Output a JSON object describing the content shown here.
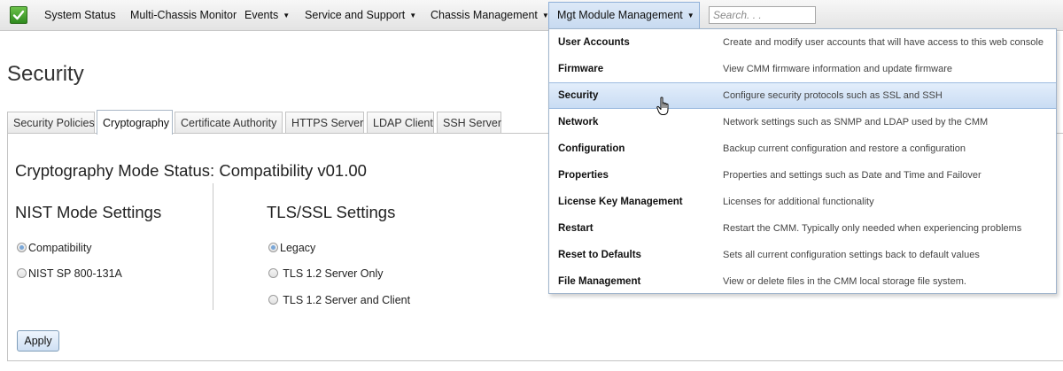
{
  "topnav": {
    "items": [
      {
        "label": "System Status",
        "caret": false
      },
      {
        "label": "Multi-Chassis Monitor",
        "caret": false
      },
      {
        "label": "Events",
        "caret": true
      },
      {
        "label": "Service and Support",
        "caret": true
      },
      {
        "label": "Chassis Management",
        "caret": true
      },
      {
        "label": "Mgt Module Management",
        "caret": true
      }
    ],
    "search_placeholder": "Search. . ."
  },
  "page": {
    "title": "Security",
    "tabs": [
      {
        "label": "Security Policies"
      },
      {
        "label": "Cryptography"
      },
      {
        "label": "Certificate Authority"
      },
      {
        "label": "HTTPS Server"
      },
      {
        "label": "LDAP Client"
      },
      {
        "label": "SSH Server"
      }
    ],
    "active_tab": "Cryptography",
    "mode_status": "Cryptography Mode Status: Compatibility v01.00",
    "nist": {
      "title": "NIST Mode Settings",
      "options": [
        "Compatibility",
        "NIST SP 800-131A"
      ],
      "selected": "Compatibility"
    },
    "tls": {
      "title": "TLS/SSL Settings",
      "options": [
        "Legacy",
        "TLS 1.2 Server Only",
        "TLS 1.2 Server and Client"
      ],
      "selected": "Legacy"
    },
    "apply_label": "Apply"
  },
  "menu": {
    "items": [
      {
        "label": "User Accounts",
        "desc": "Create and modify user accounts that will have access to this web console"
      },
      {
        "label": "Firmware",
        "desc": "View CMM firmware information and update firmware"
      },
      {
        "label": "Security",
        "desc": "Configure security protocols such as SSL and SSH"
      },
      {
        "label": "Network",
        "desc": "Network settings such as SNMP and LDAP used by the CMM"
      },
      {
        "label": "Configuration",
        "desc": "Backup current configuration and restore a configuration"
      },
      {
        "label": "Properties",
        "desc": "Properties and settings such as Date and Time and Failover"
      },
      {
        "label": "License Key Management",
        "desc": "Licenses for additional functionality"
      },
      {
        "label": "Restart",
        "desc": "Restart the CMM. Typically only needed when experiencing problems"
      },
      {
        "label": "Reset to Defaults",
        "desc": "Sets all current configuration settings back to default values"
      },
      {
        "label": "File Management",
        "desc": "View or delete files in the CMM local storage file system."
      }
    ],
    "highlighted": "Security"
  },
  "icons": {
    "logo": "green-checkmark-logo-icon",
    "caret": "caret-down-icon",
    "cursor": "hand-pointer-cursor-icon"
  },
  "colors": {
    "active_highlight": "#c9dcf3",
    "logo_green": "#3c9a2a"
  }
}
